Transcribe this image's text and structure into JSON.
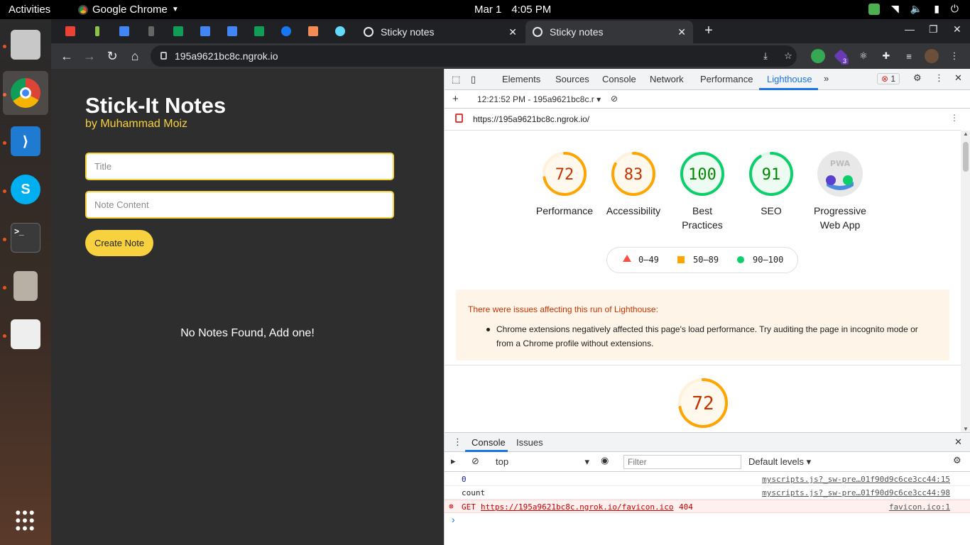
{
  "topbar": {
    "activities": "Activities",
    "app_name": "Google Chrome",
    "date": "Mar 1",
    "time": "4:05 PM"
  },
  "browser": {
    "tabs": [
      {
        "title": "Sticky notes",
        "active": false
      },
      {
        "title": "Sticky notes",
        "active": true
      }
    ],
    "url": "195a9621bc8c.ngrok.io",
    "extension_badge": "3"
  },
  "page": {
    "title": "Stick-It Notes",
    "author": "by Muhammad Moiz",
    "title_placeholder": "Title",
    "content_placeholder": "Note Content",
    "create_button": "Create Note",
    "empty_message": "No Notes Found, Add one!",
    "accent_color": "#f7d23e"
  },
  "devtools": {
    "tabs": [
      "Elements",
      "Sources",
      "Console",
      "Network",
      "Performance",
      "Lighthouse"
    ],
    "active_tab": "Lighthouse",
    "error_count": "1",
    "report_selector": "12:21:52 PM - 195a9621bc8c.r",
    "report_url": "https://195a9621bc8c.ngrok.io/",
    "scores": [
      {
        "value": "72",
        "score": 72,
        "label": "Performance",
        "color": "#ffa400"
      },
      {
        "value": "83",
        "score": 83,
        "label": "Accessibility",
        "color": "#ffa400"
      },
      {
        "value": "100",
        "score": 100,
        "label": "Best Practices",
        "color": "#0cce6b"
      },
      {
        "value": "91",
        "score": 91,
        "label": "SEO",
        "color": "#0cce6b"
      }
    ],
    "pwa": {
      "label": "Progressive Web App",
      "badge": "PWA"
    },
    "legend": [
      {
        "range": "0–49",
        "color": "#ff4e42"
      },
      {
        "range": "50–89",
        "color": "#ffa400"
      },
      {
        "range": "90–100",
        "color": "#0cce6b"
      }
    ],
    "warning": {
      "title": "There were issues affecting this run of Lighthouse:",
      "items": [
        "Chrome extensions negatively affected this page's load performance. Try auditing the page in incognito mode or from a Chrome profile without extensions."
      ]
    },
    "section_score": {
      "value": "72",
      "score": 72,
      "color": "#ffa400"
    }
  },
  "console": {
    "tabs": [
      "Console",
      "Issues"
    ],
    "context": "top",
    "filter_placeholder": "Filter",
    "levels": "Default levels",
    "messages": [
      {
        "text": "0",
        "source": "myscripts.js?_sw-pre…01f90d9c6ce3cc44:15",
        "type": "log"
      },
      {
        "text": "count",
        "source": "myscripts.js?_sw-pre…01f90d9c6ce3cc44:98",
        "type": "log"
      },
      {
        "method": "GET",
        "text": "https://195a9621bc8c.ngrok.io/favicon.ico",
        "status": "404",
        "source": "favicon.ico:1",
        "type": "error"
      }
    ],
    "prompt": "›"
  }
}
